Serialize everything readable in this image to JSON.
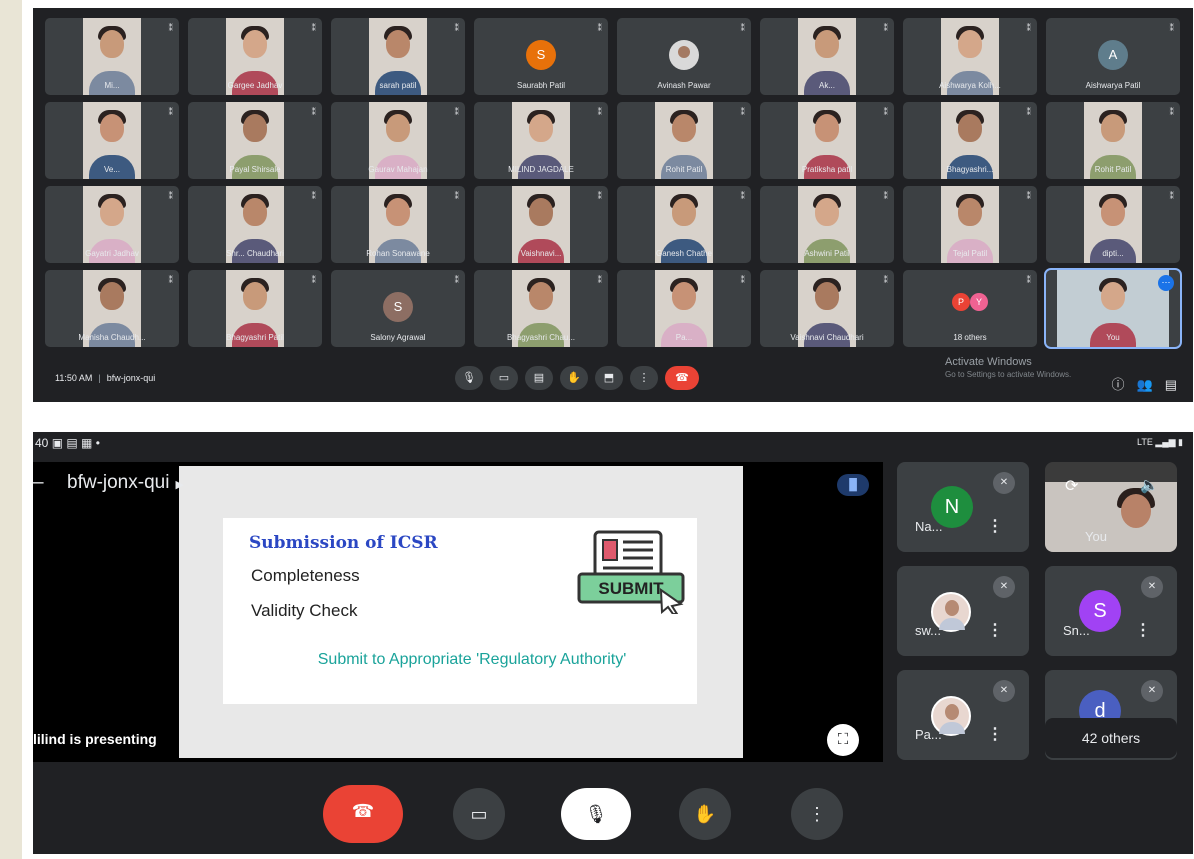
{
  "desktop_meeting": {
    "time": "11:50 AM",
    "meeting_code": "bfw-jonx-qui",
    "windows_watermark": {
      "title": "Activate Windows",
      "subtitle": "Go to Settings to activate Windows."
    },
    "tiles": [
      {
        "name": "Mi...",
        "kind": "video"
      },
      {
        "name": "Gargee Jadhav",
        "kind": "video"
      },
      {
        "name": "sarah patil",
        "kind": "video"
      },
      {
        "name": "Saurabh Patil",
        "kind": "avatar",
        "initial": "S",
        "color": "#e8710a"
      },
      {
        "name": "Avinash Pawar",
        "kind": "avatar-photo"
      },
      {
        "name": "Ak...",
        "kind": "video"
      },
      {
        "name": "Aishwarya Kolh...",
        "kind": "video"
      },
      {
        "name": "Aishwarya Patil",
        "kind": "avatar",
        "initial": "A",
        "color": "#5f7d8c"
      },
      {
        "name": "Ve...",
        "kind": "video"
      },
      {
        "name": "Payal Shirsale",
        "kind": "video"
      },
      {
        "name": "Gaurav Mahajan",
        "kind": "video"
      },
      {
        "name": "MILIND JAGDALE",
        "kind": "video"
      },
      {
        "name": "Rohit Patil",
        "kind": "video"
      },
      {
        "name": "Pratiksha patil",
        "kind": "video"
      },
      {
        "name": "Bhagyashri...",
        "kind": "video"
      },
      {
        "name": "Rohit Patil",
        "kind": "video"
      },
      {
        "name": "Gayatri Jadhav",
        "kind": "video"
      },
      {
        "name": "Shr... Chaudhari",
        "kind": "video"
      },
      {
        "name": "Rohan Sonawane",
        "kind": "video"
      },
      {
        "name": "Vaishnavi...",
        "kind": "video"
      },
      {
        "name": "Ganesh Chathe",
        "kind": "video"
      },
      {
        "name": "Ashwini Patil",
        "kind": "video"
      },
      {
        "name": "Tejal Patil",
        "kind": "video"
      },
      {
        "name": "dipti...",
        "kind": "video"
      },
      {
        "name": "Manisha Chaudh...",
        "kind": "video"
      },
      {
        "name": "Bhagyashri Patil",
        "kind": "video"
      },
      {
        "name": "Salony Agrawal",
        "kind": "avatar",
        "initial": "S",
        "color": "#8d6e63"
      },
      {
        "name": "Bhagyashri Chau...",
        "kind": "video"
      },
      {
        "name": "Pa...",
        "kind": "video"
      },
      {
        "name": "Vaishnavi Chaudhari",
        "kind": "video"
      },
      {
        "name": "18 others",
        "kind": "others"
      },
      {
        "name": "You",
        "kind": "self"
      }
    ],
    "others_chips": [
      {
        "initial": "P",
        "color": "#ea4335"
      },
      {
        "initial": "Y",
        "color": "#f06292"
      }
    ],
    "controls": [
      "mic-icon",
      "camera-icon",
      "captions-icon",
      "raise-hand-icon",
      "present-icon",
      "more-icon",
      "end-call-icon"
    ]
  },
  "mobile_meeting": {
    "status_time": "40",
    "meeting_code": "bfw-jonx-qui",
    "presenter_text": "lilind is presenting",
    "slide": {
      "title": "Submission of ICSR",
      "line1": "Completeness",
      "line2": "Validity Check",
      "cta": "Submit to Appropriate 'Regulatory Authority'",
      "submit_label": "SUBMIT"
    },
    "participants": [
      {
        "name": "Na...",
        "initial": "N",
        "color": "#1e8e3e",
        "photo": false
      },
      {
        "name": "sw...",
        "initial": "",
        "color": "",
        "photo": true
      },
      {
        "name": "Sn...",
        "initial": "S",
        "color": "#a142f4",
        "photo": false
      },
      {
        "name": "Pa...",
        "initial": "",
        "color": "",
        "photo": true
      },
      {
        "name": "",
        "initial": "d",
        "color": "#4a5fc1",
        "photo": false
      }
    ],
    "self_label": "You",
    "others_count": "42 others",
    "accent": "#ea4335"
  }
}
